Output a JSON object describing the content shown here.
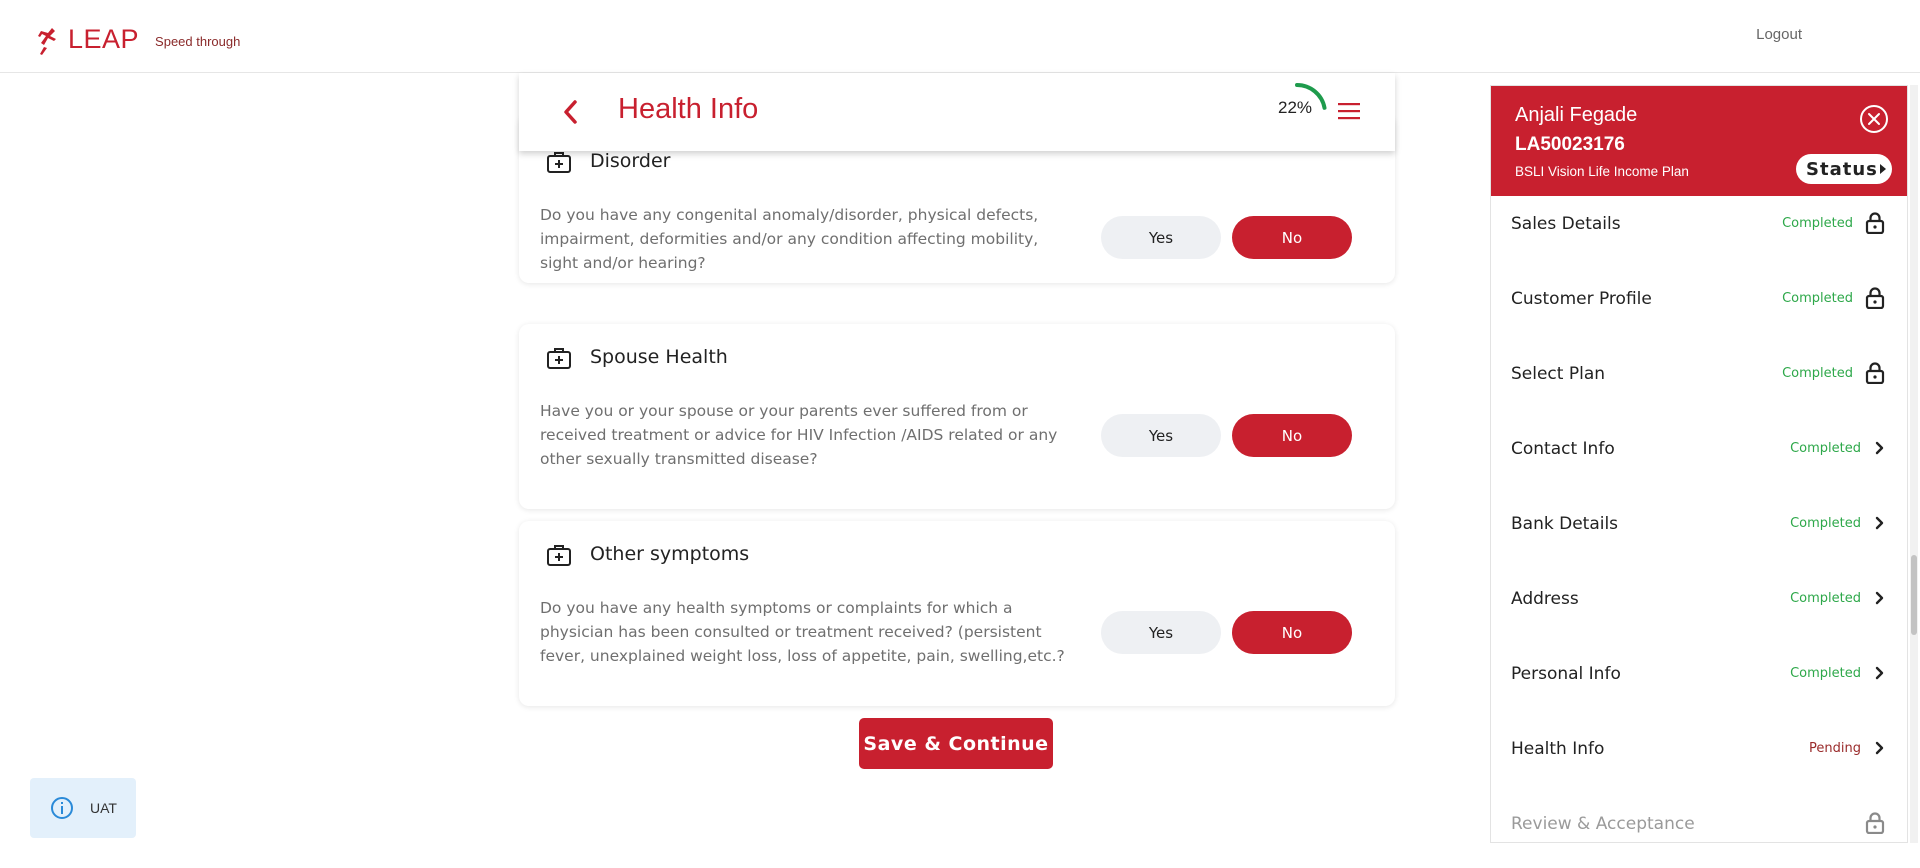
{
  "brand": {
    "name": "LEAP",
    "tagline": "Speed through"
  },
  "topbar": {
    "logout_label": "Logout"
  },
  "header": {
    "title": "Health Info",
    "progress_text": "22%",
    "progress_value": 22
  },
  "questions": [
    {
      "title": "Disorder",
      "question": "Do you have any congenital anomaly/disorder, physical defects, impairment, deformities and/or any condition affecting mobility, sight and/or hearing?",
      "yes_label": "Yes",
      "no_label": "No",
      "selected": "No"
    },
    {
      "title": "Spouse Health",
      "question": "Have you or your spouse or your parents ever suffered from or received treatment or advice for HIV Infection /AIDS related or any other sexually transmitted disease?",
      "yes_label": "Yes",
      "no_label": "No",
      "selected": "No"
    },
    {
      "title": "Other symptoms",
      "question": "Do you have any health symptoms or complaints for which a physician has been consulted or treatment received? (persistent fever, unexplained weight loss, loss of appetite, pain, swelling,etc.?",
      "yes_label": "Yes",
      "no_label": "No",
      "selected": "No"
    }
  ],
  "save_label": "Save & Continue",
  "uat_label": "UAT",
  "panel": {
    "name": "Anjali Fegade",
    "id": "LA50023176",
    "plan": "BSLI Vision Life Income Plan",
    "status_label": "Status",
    "steps": [
      {
        "label": "Sales Details",
        "status": "Completed",
        "icon": "lock-icon"
      },
      {
        "label": "Customer Profile",
        "status": "Completed",
        "icon": "lock-icon"
      },
      {
        "label": "Select Plan",
        "status": "Completed",
        "icon": "lock-icon"
      },
      {
        "label": "Contact Info",
        "status": "Completed",
        "icon": "chevron-right-icon"
      },
      {
        "label": "Bank Details",
        "status": "Completed",
        "icon": "chevron-right-icon"
      },
      {
        "label": "Address",
        "status": "Completed",
        "icon": "chevron-right-icon"
      },
      {
        "label": "Personal Info",
        "status": "Completed",
        "icon": "chevron-right-icon"
      },
      {
        "label": "Health Info",
        "status": "Pending",
        "icon": "chevron-right-icon"
      },
      {
        "label": "Review & Acceptance",
        "status": "",
        "icon": "lock-icon"
      }
    ]
  },
  "colors": {
    "brand_red": "#c8202f",
    "completed_green": "#2ea84a",
    "pending_red": "#9a2b2b",
    "progress_green": "#1e9b4c"
  }
}
